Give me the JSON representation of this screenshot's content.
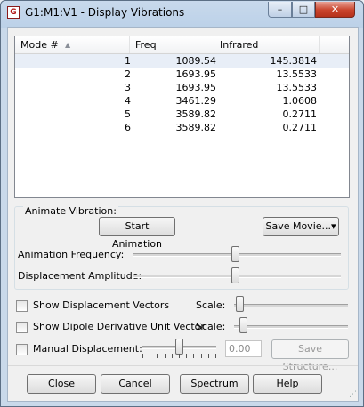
{
  "window": {
    "title": "G1:M1:V1 - Display Vibrations",
    "app_icon_glyph": "G",
    "minimize_glyph": "–",
    "maximize_glyph": "□",
    "close_glyph": "✕"
  },
  "table": {
    "columns": [
      "Mode #",
      "Freq",
      "Infrared"
    ],
    "sort_indicator": "▲",
    "rows": [
      {
        "mode": "1",
        "freq": "1089.54",
        "ir": "145.3814"
      },
      {
        "mode": "2",
        "freq": "1693.95",
        "ir": "13.5533"
      },
      {
        "mode": "3",
        "freq": "1693.95",
        "ir": "13.5533"
      },
      {
        "mode": "4",
        "freq": "3461.29",
        "ir": "1.0608"
      },
      {
        "mode": "5",
        "freq": "3589.82",
        "ir": "0.2711"
      },
      {
        "mode": "6",
        "freq": "3589.82",
        "ir": "0.2711"
      }
    ]
  },
  "animate": {
    "group_label": "Animate Vibration:",
    "start_button": "Start Animation",
    "save_movie_button": "Save Movie...▾",
    "frequency_label": "Animation Frequency:",
    "frequency_level": 0.49,
    "amplitude_label": "Displacement Amplitude:",
    "amplitude_level": 0.49
  },
  "options": {
    "show_vectors_label": "Show Displacement Vectors",
    "show_vectors_checked": false,
    "vectors_scale_label": "Scale:",
    "vectors_scale_level": 0.02,
    "show_dipole_label": "Show Dipole Derivative Unit Vector",
    "show_dipole_checked": false,
    "dipole_scale_label": "Scale:",
    "dipole_scale_level": 0.05,
    "manual_label": "Manual Displacement:",
    "manual_checked": false,
    "manual_level": 0.5,
    "manual_value": "0.00",
    "save_structure_button": "Save Structure..."
  },
  "buttons": {
    "close": "Close",
    "cancel": "Cancel",
    "spectrum": "Spectrum",
    "help": "Help"
  }
}
